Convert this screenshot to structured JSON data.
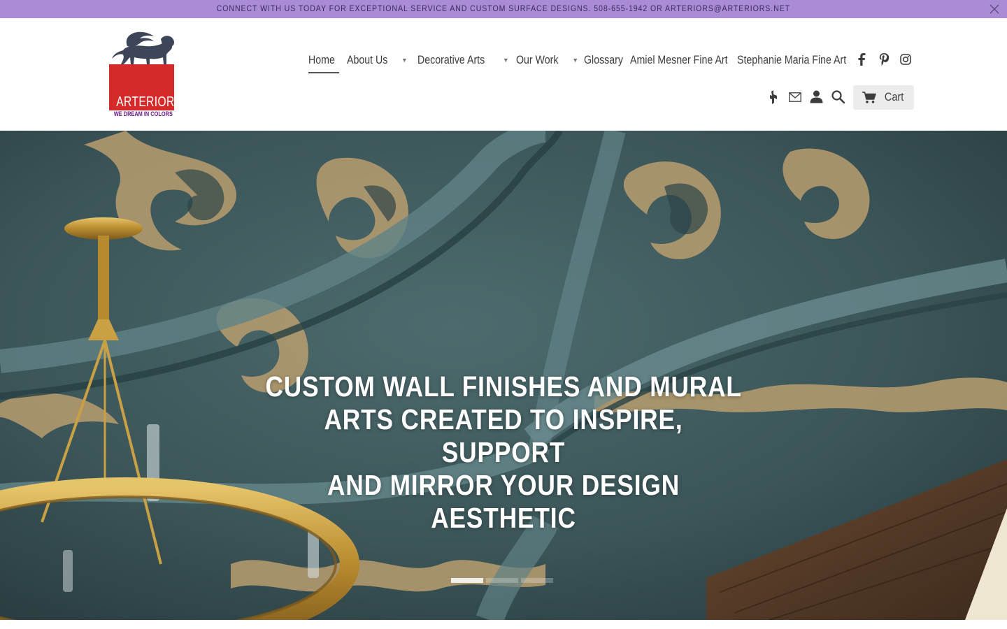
{
  "announcement": {
    "text": "CONNECT WITH US TODAY FOR EXCEPTIONAL SERVICE AND CUSTOM SURFACE DESIGNS. 508-655-1942 OR ARTERIORS@ARTERIORS.NET",
    "close_icon": "close-icon"
  },
  "logo": {
    "wordmark": "ARTERIORS",
    "tagline": "WE DREAM IN COLORS"
  },
  "nav": {
    "items": [
      {
        "label": "Home",
        "active": true,
        "dropdown": false
      },
      {
        "label": "About Us",
        "active": false,
        "dropdown": true
      },
      {
        "label": "Decorative Arts",
        "active": false,
        "dropdown": true
      },
      {
        "label": "Our Work",
        "active": false,
        "dropdown": true
      },
      {
        "label": "Glossary",
        "active": false,
        "dropdown": false
      },
      {
        "label": "Amiel Mesner Fine Art",
        "active": false,
        "dropdown": false
      },
      {
        "label": "Stephanie Maria Fine Art",
        "active": false,
        "dropdown": false
      }
    ],
    "caret": "▼"
  },
  "social": [
    "facebook-icon",
    "pinterest-icon",
    "instagram-icon"
  ],
  "utilities": [
    "houzz-icon",
    "mail-icon",
    "account-icon",
    "search-icon"
  ],
  "cart": {
    "label": "Cart",
    "icon": "cart-icon"
  },
  "hero": {
    "heading_lines": [
      "CUSTOM WALL FINISHES AND MURAL",
      "ARTS CREATED TO INSPIRE, SUPPORT",
      "AND MIRROR YOUR DESIGN AESTHETIC"
    ],
    "slides": 3,
    "active_slide": 0
  },
  "colors": {
    "announcement_bg": "#a98bd6",
    "logo_red": "#d62a2a",
    "tagline_purple": "#6a1a8a",
    "ceiling_teal": "#3f5a5e",
    "ornament_gold": "#b99d6e",
    "brass": "#c9a043"
  }
}
